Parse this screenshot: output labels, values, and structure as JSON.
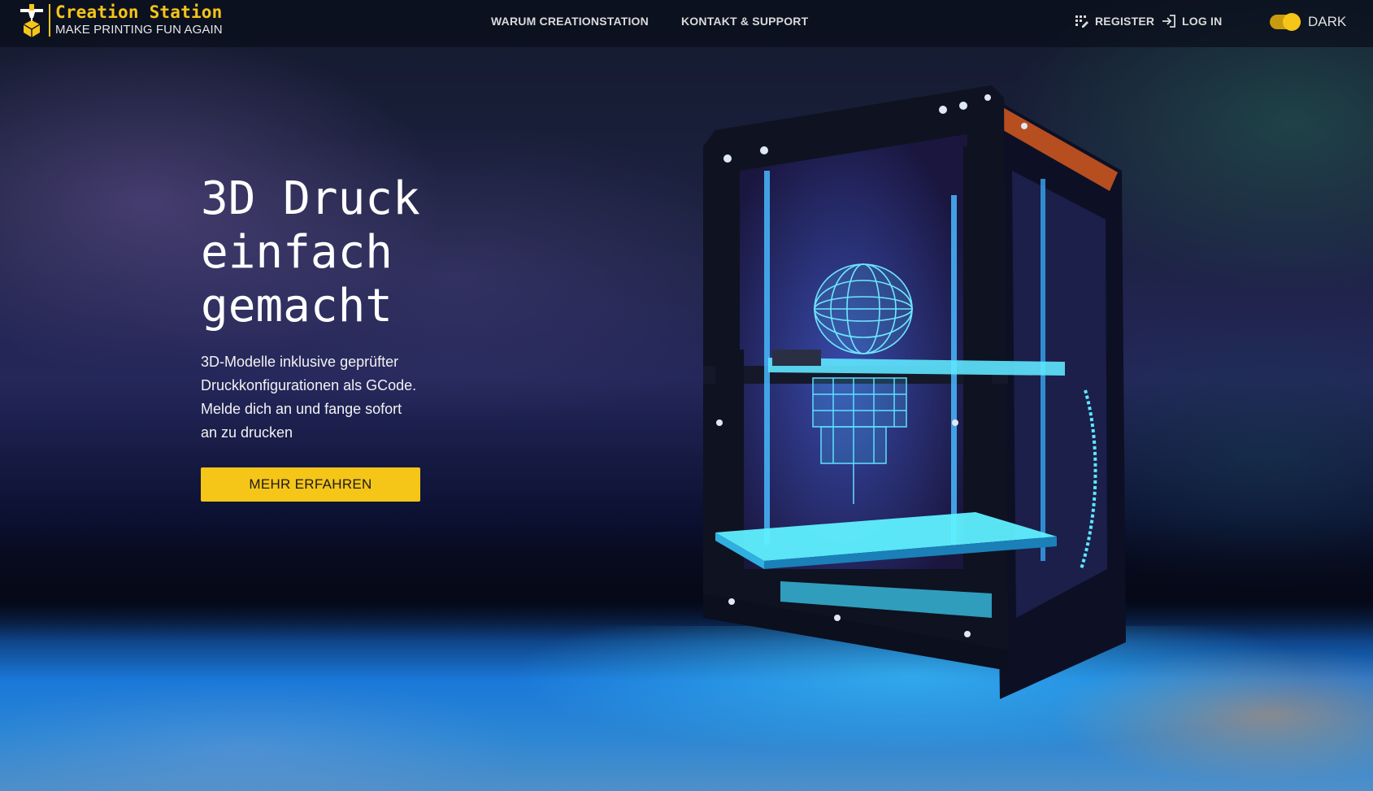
{
  "header": {
    "brand": {
      "title": "Creation Station",
      "tagline": "MAKE PRINTING FUN AGAIN",
      "logo_icon": "printer-nozzle-logo-icon"
    },
    "nav": {
      "items": [
        {
          "label": "WARUM CREATIONSTATION"
        },
        {
          "label": "KONTAKT & SUPPORT"
        }
      ]
    },
    "auth": {
      "register_label": "REGISTER",
      "register_icon": "register-icon",
      "login_label": "LOG IN",
      "login_icon": "login-icon"
    },
    "theme_toggle": {
      "label": "DARK",
      "enabled": true
    }
  },
  "hero": {
    "title_lines": [
      "3D Druck",
      "einfach",
      "gemacht"
    ],
    "description_lines": [
      "3D-Modelle inklusive geprüfter",
      "Druckkonfigurationen als GCode.",
      "Melde dich an und fange sofort",
      "an zu drucken"
    ],
    "cta_label": "MEHR ERFAHREN"
  },
  "colors": {
    "accent": "#f5c518",
    "header_bg": "#0a0e1a",
    "text_primary": "#ffffff",
    "nav_text": "#d9d9d9",
    "printer_glow": "#38e0ff"
  }
}
